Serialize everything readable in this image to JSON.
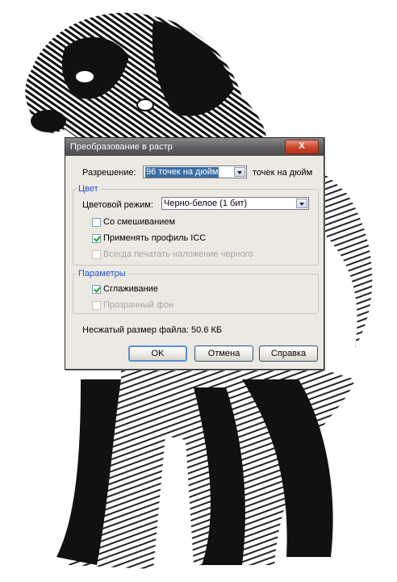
{
  "dialog": {
    "title": "Преобразование в растр",
    "close_label": "X"
  },
  "resolution": {
    "label": "Разрешение:",
    "value": "96 точек на дюйм",
    "unit": "точек на дюйм"
  },
  "color_group": {
    "title": "Цвет",
    "mode_label": "Цветовой режим:",
    "mode_value": "Черно-белое (1 бит)",
    "dithering": {
      "label": "Со смешиванием",
      "checked": false
    },
    "icc": {
      "label": "Применять профиль ICC",
      "checked": true
    },
    "overprint_black": {
      "label": "Всегда печатать наложение черного",
      "checked": false,
      "disabled": true
    }
  },
  "params_group": {
    "title": "Параметры",
    "antialias": {
      "label": "Сглаживание",
      "checked": true
    },
    "transparent": {
      "label": "Прозрачный фон",
      "checked": false,
      "disabled": true
    }
  },
  "file_size": "Несжатый размер файла: 50.6 КБ",
  "buttons": {
    "ok": "OK",
    "cancel": "Отмена",
    "help": "Справка"
  }
}
